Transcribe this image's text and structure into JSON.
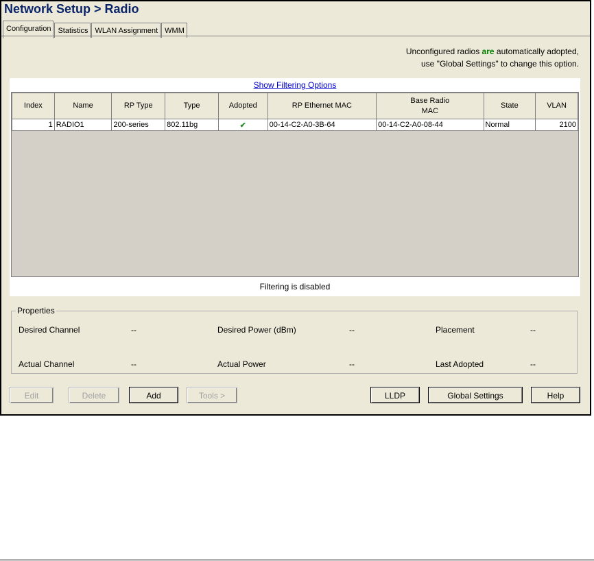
{
  "window": {
    "title": "Network Setup > Radio"
  },
  "tabs": [
    {
      "label": "Configuration"
    },
    {
      "label": "Statistics"
    },
    {
      "label": "WLAN Assignment"
    },
    {
      "label": "WMM"
    }
  ],
  "notice": {
    "line1_before": "Unconfigured radios ",
    "line1_em": "are",
    "line1_after": " automatically adopted,",
    "line2": "use \"Global Settings\" to change this option."
  },
  "filter": {
    "link_label": "Show Filtering Options",
    "status": "Filtering is disabled"
  },
  "table": {
    "headers": [
      "Index",
      "Name",
      "RP Type",
      "Type",
      "Adopted",
      "RP Ethernet MAC",
      "Base Radio",
      "MAC",
      "State",
      "VLAN"
    ],
    "rows": [
      {
        "index": "1",
        "name": "RADIO1",
        "rp_type": "200-series",
        "type": "802.11bg",
        "adopted": "✔",
        "rp_mac": "00-14-C2-A0-3B-64",
        "base_mac": "00-14-C2-A0-08-44",
        "state": "Normal",
        "vlan": "2100"
      }
    ]
  },
  "properties": {
    "legend": "Properties",
    "desired_channel_label": "Desired Channel",
    "desired_channel_value": "--",
    "desired_power_label": "Desired Power (dBm)",
    "desired_power_value": "--",
    "placement_label": "Placement",
    "placement_value": "--",
    "actual_channel_label": "Actual Channel",
    "actual_channel_value": "--",
    "actual_power_label": "Actual Power",
    "actual_power_value": "--",
    "last_adopted_label": "Last Adopted",
    "last_adopted_value": "--"
  },
  "buttons": {
    "edit": "Edit",
    "delete": "Delete",
    "add": "Add",
    "tools": "Tools >",
    "lldp": "LLDP",
    "global_settings": "Global Settings",
    "help": "Help"
  },
  "colors": {
    "title": "#0A246A",
    "accent_green": "#008000",
    "link": "#0000CC",
    "background": "#ECE9D8"
  }
}
